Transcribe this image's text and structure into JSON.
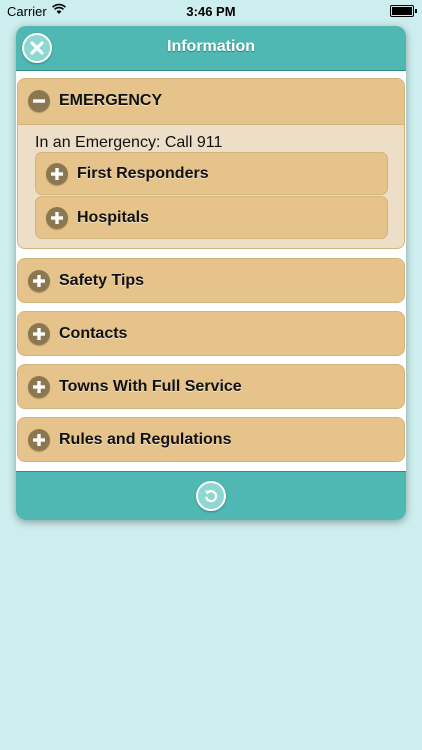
{
  "status_bar": {
    "carrier": "Carrier",
    "time": "3:46 PM",
    "wifi_icon": "wifi-icon",
    "battery_icon": "battery-icon"
  },
  "header": {
    "title": "Information",
    "close_icon": "close-icon"
  },
  "emergency": {
    "label": "EMERGENCY",
    "expanded": true,
    "text": "In an Emergency: Call 911",
    "sub_items": [
      {
        "label": "First Responders"
      },
      {
        "label": "Hospitals"
      }
    ]
  },
  "sections": [
    {
      "label": "Safety Tips"
    },
    {
      "label": "Contacts"
    },
    {
      "label": "Towns With Full Service"
    },
    {
      "label": "Rules and Regulations"
    }
  ],
  "footer": {
    "refresh_icon": "refresh-icon"
  },
  "colors": {
    "background": "#cdeeee",
    "teal": "#4fb8b3",
    "section": "#e5c38a",
    "expanded_body": "#eddfc7",
    "icon": "#8c7850"
  }
}
